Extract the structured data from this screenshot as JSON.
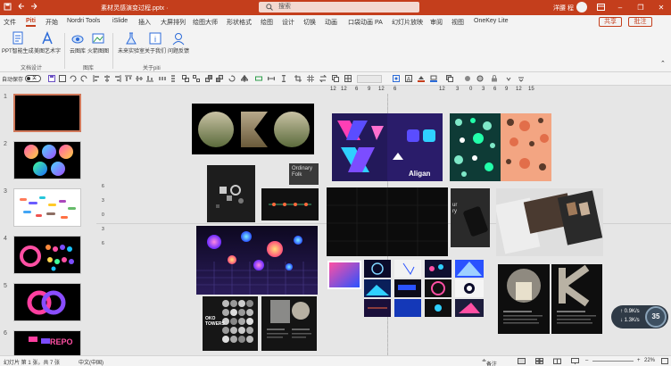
{
  "window": {
    "file_title": "素材灵感演变过程.pptx ·",
    "search_placeholder": "搜索",
    "user_name": "洋腰 程",
    "minimize": "–",
    "restore": "❐",
    "close": "✕"
  },
  "menu": {
    "tabs": [
      "文件",
      "Piti",
      "开始",
      "Nordri Tools",
      "iSlide",
      "插入",
      "大屏排列",
      "绘图大师",
      "形状格式",
      "绘图",
      "设计",
      "切换",
      "动画",
      "口袋动画 PA",
      "幻灯片放映",
      "审阅",
      "视图",
      "OneKey Lite"
    ],
    "active_tab": "Piti",
    "share": "共享",
    "comment": "批注"
  },
  "ribbon": {
    "buttons": [
      {
        "label": "PPT智能生成",
        "icon": "document-ai-icon"
      },
      {
        "label": "美图艺术字",
        "icon": "art-text-icon"
      },
      {
        "label": "云图库",
        "icon": "cloud-library-icon"
      },
      {
        "label": "火箭图图",
        "icon": "rocket-image-icon"
      },
      {
        "label": "未来实验室",
        "icon": "lab-flask-icon"
      },
      {
        "label": "关于我们",
        "icon": "about-us-icon"
      },
      {
        "label": "问题反馈",
        "icon": "feedback-icon"
      }
    ],
    "groups": [
      "文档设计",
      "图库",
      "关于piti"
    ]
  },
  "toolbar": {
    "autosave_label": "自动保存",
    "autosave_state": "关"
  },
  "ruler": {
    "ticks": [
      "12",
      "12",
      "6",
      "9",
      "12",
      "6",
      "12",
      "3",
      "0",
      "3",
      "6",
      "9",
      "12",
      "15"
    ],
    "vertical_ticks": [
      "6",
      "3",
      "0",
      "3",
      "6"
    ]
  },
  "thumbnails": {
    "numbers": [
      "1",
      "2",
      "3",
      "4",
      "5",
      "6"
    ],
    "selected": 1,
    "slide6_text": "REPO"
  },
  "canvas": {
    "text_ordinary": "Ordinary Folk",
    "text_aligan": "Aligan",
    "text_oko": "OKO TOWERS",
    "text_ury": "ur\nry"
  },
  "statusbar": {
    "slide_info": "幻灯片 第 1 张，共 7 张",
    "language": "中文(中国)",
    "notes": "备注",
    "zoom": "22%"
  },
  "netwidget": {
    "up": "0.9",
    "down": "1.3",
    "up_unit": "K/s",
    "down_unit": "K/s",
    "value": "35"
  },
  "colors": {
    "brand": "#c43e1c",
    "accent_blue": "#2c6bd8"
  }
}
